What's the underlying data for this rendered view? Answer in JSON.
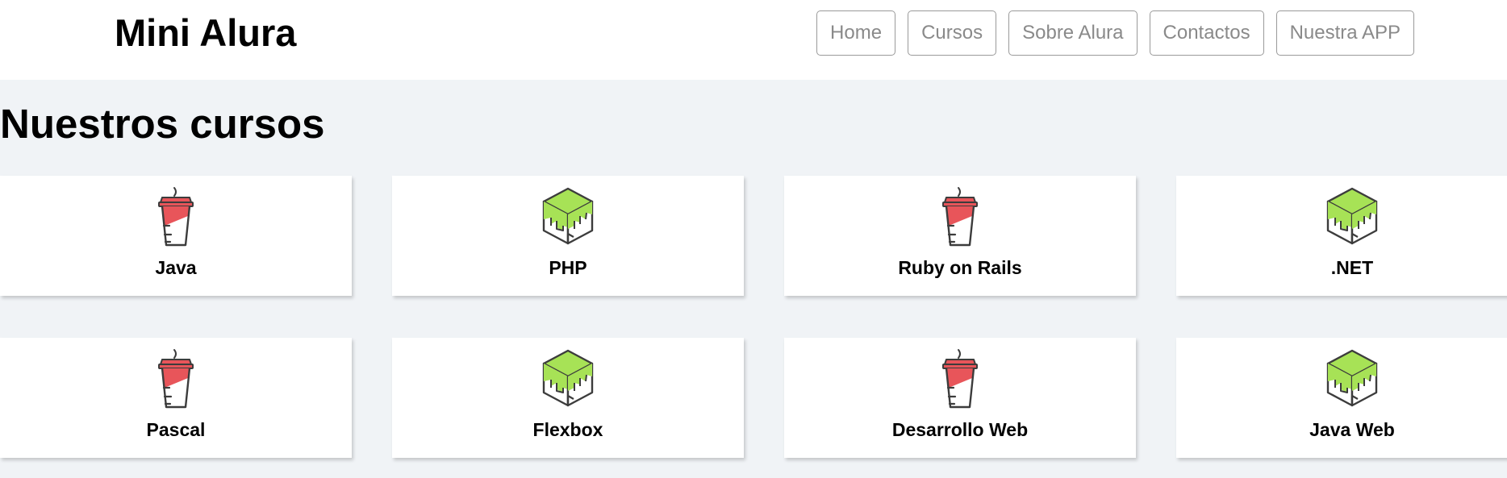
{
  "header": {
    "brand": "Mini Alura",
    "nav": [
      "Home",
      "Cursos",
      "Sobre Alura",
      "Contactos",
      "Nuestra APP"
    ]
  },
  "main": {
    "title": "Nuestros cursos",
    "courses": [
      {
        "label": "Java",
        "icon": "coffee-cup-icon"
      },
      {
        "label": "PHP",
        "icon": "green-cube-icon"
      },
      {
        "label": "Ruby on Rails",
        "icon": "coffee-cup-icon"
      },
      {
        "label": ".NET",
        "icon": "green-cube-icon"
      },
      {
        "label": "Pascal",
        "icon": "coffee-cup-icon"
      },
      {
        "label": "Flexbox",
        "icon": "green-cube-icon"
      },
      {
        "label": "Desarrollo Web",
        "icon": "coffee-cup-icon"
      },
      {
        "label": "Java Web",
        "icon": "green-cube-icon"
      }
    ]
  },
  "colors": {
    "page_bg": "#f0f3f6",
    "header_bg": "#ffffff",
    "nav_text": "#8a8a8a",
    "cup_red": "#e8555a",
    "cube_green": "#a7e256",
    "icon_stroke": "#3c3c3c"
  }
}
